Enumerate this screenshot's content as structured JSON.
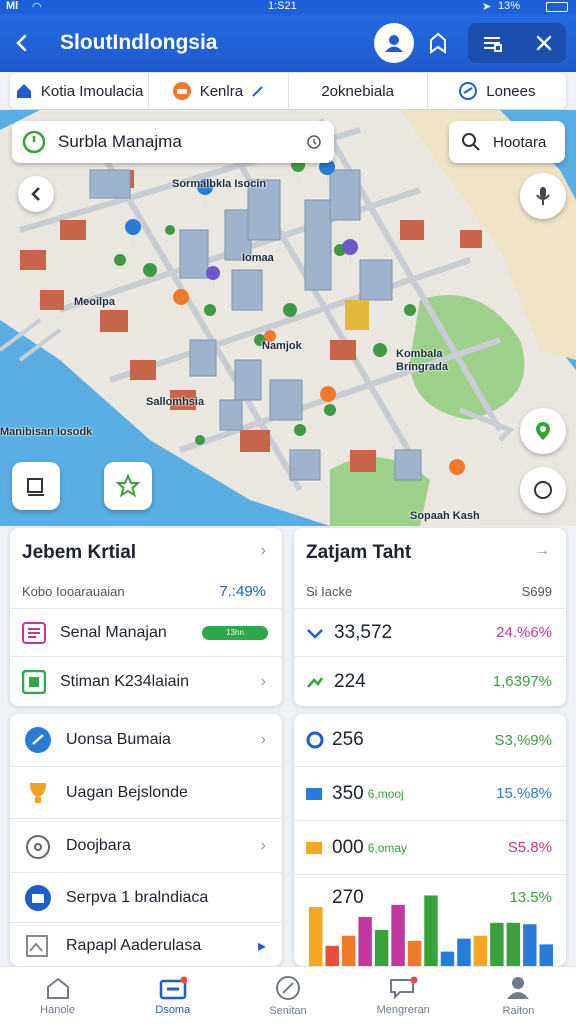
{
  "status": {
    "carrier": "Ml",
    "time": "1:S21",
    "battery": "13%"
  },
  "header": {
    "title": "SloutIndlongsia"
  },
  "tabs": [
    {
      "label": "Kotia Imoulacia",
      "icon": "home-icon",
      "color": "#1f5ccd"
    },
    {
      "label": "Kenlra",
      "icon": "transit-icon",
      "color": "#f07a2c"
    },
    {
      "label": "2oknebiala",
      "icon": "",
      "color": ""
    },
    {
      "label": "Lonees",
      "icon": "location-icon",
      "color": "#1f5ccd"
    }
  ],
  "map": {
    "search_chip": "Surbla Manajma",
    "right_chip": "Hootara",
    "labels": [
      "Sormalbkla Isocin",
      "Iomaa",
      "Meoilpa",
      "Namjok",
      "Kombala Bringrada",
      "Sallomhsia",
      "Manibisan Iosodk",
      "Sopaah Kash"
    ]
  },
  "cards": {
    "left": {
      "title": "Jebem Krtial",
      "subtitle": "Kobo Iooarauaian",
      "percent": "7.:49%",
      "rows": [
        {
          "label": "Senal Manajan",
          "badge": "13hn"
        },
        {
          "label": "Stiman K234laiain"
        }
      ]
    },
    "right": {
      "title": "Zatjam Taht",
      "subtitle": "Si Iacke",
      "value_header": "S699",
      "rows": [
        {
          "value": "33,572",
          "pct": "24.%6%",
          "color": "#c2379b"
        },
        {
          "value": "224",
          "pct": "1,6397%",
          "color": "#3aa13c"
        }
      ]
    },
    "list": [
      {
        "label": "Uonsa Bumaia",
        "color": "#2a7ad8"
      },
      {
        "label": "Uagan Bejslonde",
        "color": "#f0a020"
      },
      {
        "label": "Doojbara",
        "color": "#666"
      },
      {
        "label": "Serpva 1 bralndiaca",
        "color": "#1f5ccd"
      },
      {
        "label": "Rapapl Aaderulasa",
        "color": "#888"
      }
    ],
    "stats": [
      {
        "value": "256",
        "sub": "",
        "pct": "S3,%9%",
        "pct_color": "#3aa13c"
      },
      {
        "value": "350",
        "sub": "6,mooj",
        "pct": "15.%8%",
        "pct_color": "#2a7ad8"
      },
      {
        "value": "000",
        "sub": "6,omay",
        "pct": "S5.8%",
        "pct_color": "#c2379b"
      },
      {
        "value": "270",
        "sub": "",
        "pct": "13.5%",
        "pct_color": "#3aa13c"
      }
    ],
    "mini_chart": {
      "type": "bar",
      "values": [
        0.82,
        0.28,
        0.42,
        0.68,
        0.5,
        0.85,
        0.35,
        0.98,
        0.2,
        0.38,
        0.42,
        0.6,
        0.6,
        0.58,
        0.3
      ],
      "colors": [
        "#f5a623",
        "#e84e3c",
        "#f07a2c",
        "#c2379b",
        "#3aa13c",
        "#c2379b",
        "#f07a2c",
        "#3aa13c",
        "#2a7ad8",
        "#2a7ad8",
        "#f5a623",
        "#3aa13c",
        "#3aa13c",
        "#2a7ad8",
        "#2a7ad8"
      ]
    }
  },
  "nav": [
    {
      "label": "Hanole",
      "icon": "home-icon"
    },
    {
      "label": "Dsoma",
      "icon": "wallet-icon"
    },
    {
      "label": "Senitan",
      "icon": "compass-icon"
    },
    {
      "label": "Mengreran",
      "icon": "message-icon"
    },
    {
      "label": "Raiton",
      "icon": "profile-icon"
    }
  ]
}
